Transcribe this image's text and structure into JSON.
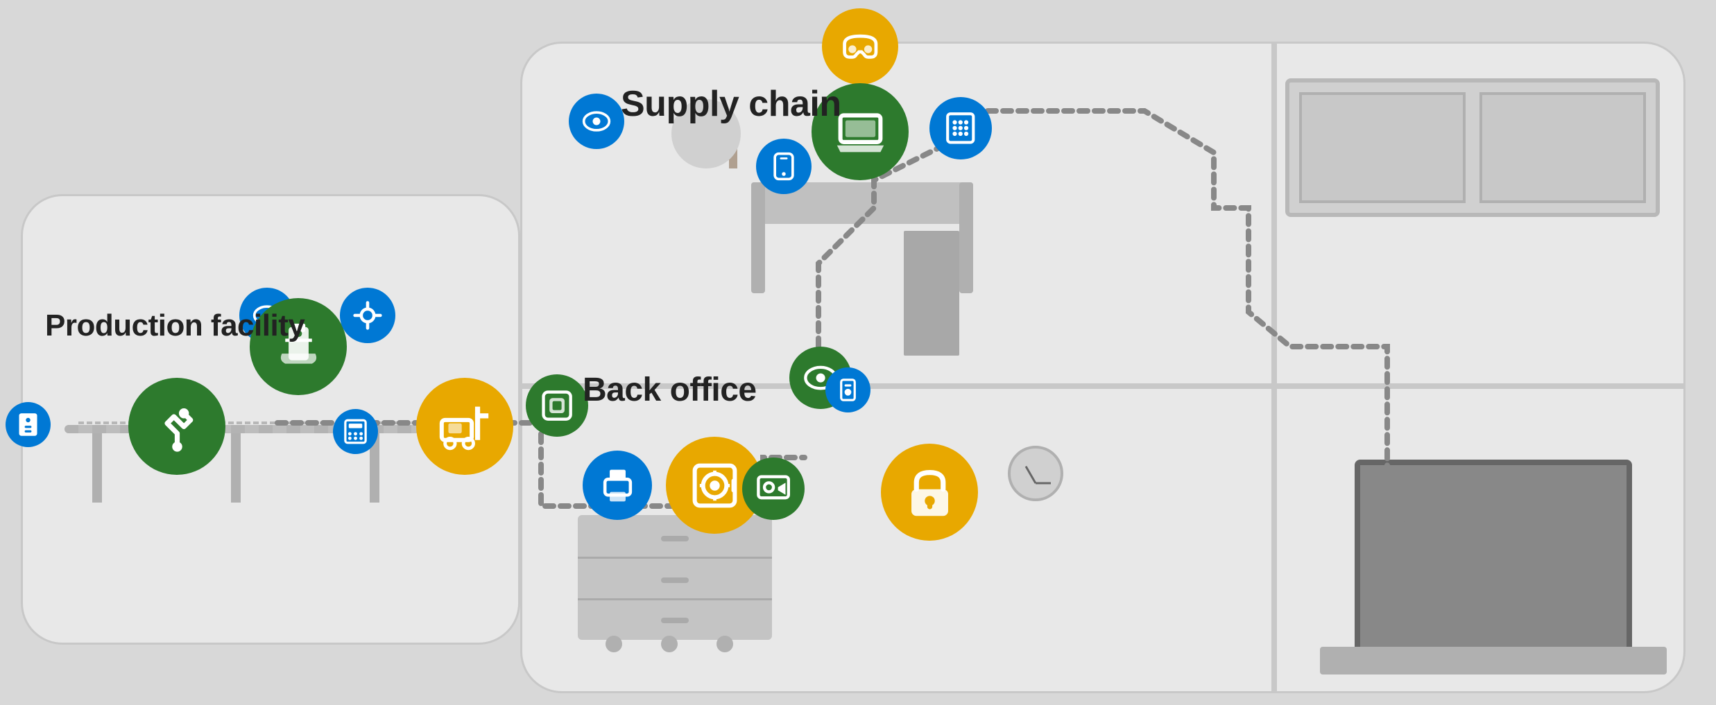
{
  "areas": {
    "production": {
      "label": "Production facility"
    },
    "back_office": {
      "label": "Back office"
    },
    "supply_chain": {
      "label": "Supply chain"
    }
  },
  "colors": {
    "green": "#2d7a2d",
    "blue": "#0078d4",
    "yellow": "#e8a800",
    "bg_building": "#e8e8e8",
    "bg_page": "#d4d4d4"
  }
}
